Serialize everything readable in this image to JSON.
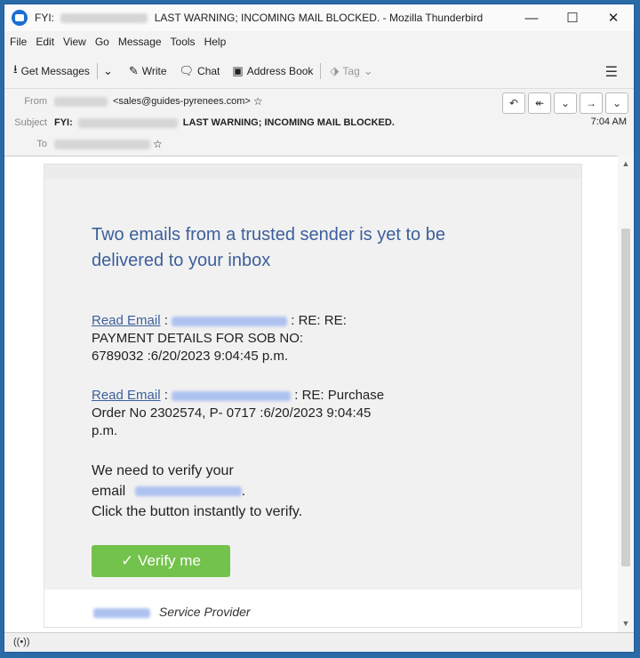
{
  "window": {
    "title_prefix": "FYI:",
    "title_main": "LAST WARNING; INCOMING MAIL BLOCKED. - Mozilla Thunderbird",
    "controls": {
      "minimize": "—",
      "maximize": "☐",
      "close": "✕"
    }
  },
  "menu": [
    "File",
    "Edit",
    "View",
    "Go",
    "Message",
    "Tools",
    "Help"
  ],
  "toolbar": {
    "get_messages": "Get Messages",
    "write": "Write",
    "chat": "Chat",
    "address_book": "Address Book",
    "tag": "Tag"
  },
  "header": {
    "from_label": "From",
    "from_value": "<sales@guides-pyrenees.com>",
    "subject_label": "Subject",
    "subject_prefix": "FYI:",
    "subject_text": "LAST WARNING; INCOMING MAIL BLOCKED.",
    "to_label": "To",
    "time": "7:04 AM"
  },
  "email": {
    "heading": "Two  emails from a trusted sender is yet to be delivered to your inbox",
    "item1_link": "Read Email",
    "item1_text_a": ": RE: RE:",
    "item1_text_b": "PAYMENT DETAILS FOR SOB NO:",
    "item1_text_c": "6789032   :6/20/2023 9:04:45 p.m.",
    "item2_link": "Read Email",
    "item2_text_a": ": RE: Purchase",
    "item2_text_b": "Order No 2302574, P- 0717    :6/20/2023 9:04:45",
    "item2_text_c": "p.m.",
    "verify_line1": "We need to verify your",
    "verify_line2": "email",
    "verify_line3": "Click the button instantly to verify.",
    "button": "✓ Verify me",
    "footer": "Service Provider"
  },
  "status": {
    "icon": "((•))"
  }
}
